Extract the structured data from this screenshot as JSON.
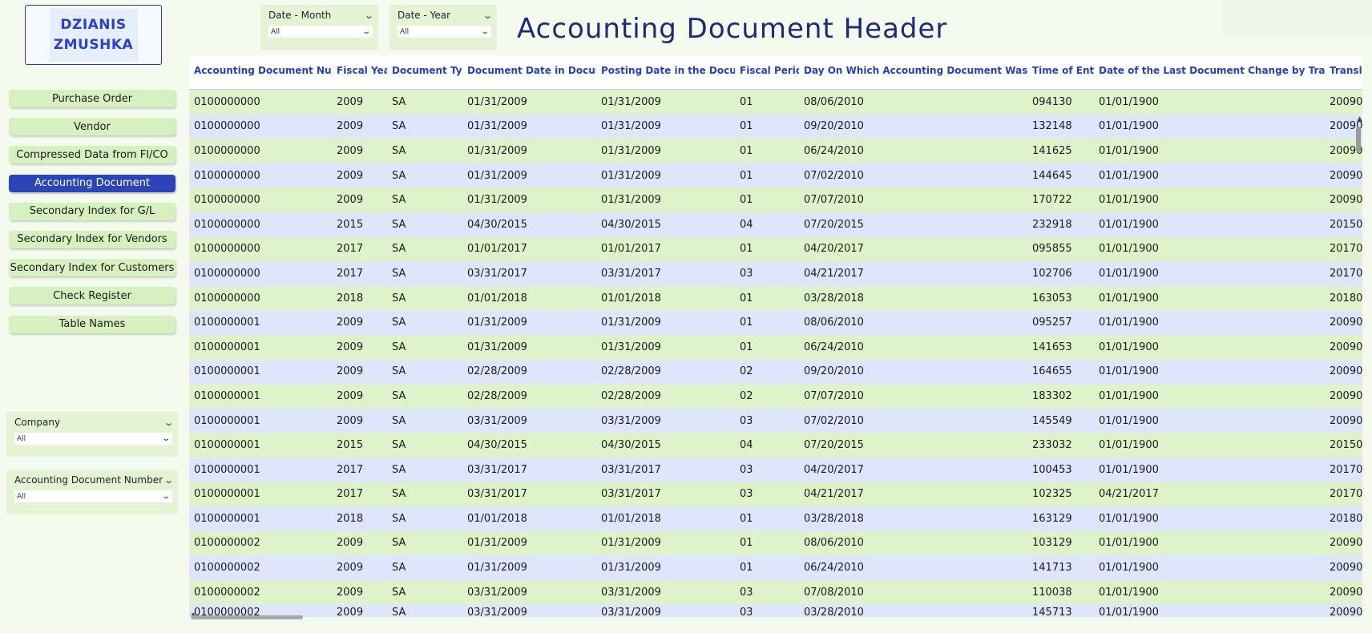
{
  "logo": {
    "line1": "DZIANIS",
    "line2": "ZMUSHKA"
  },
  "title": "Accounting Document Header",
  "nav": [
    {
      "label": "Purchase Order",
      "active": false
    },
    {
      "label": "Vendor",
      "active": false
    },
    {
      "label": "Compressed Data from FI/CO",
      "active": false
    },
    {
      "label": "Accounting Document",
      "active": true
    },
    {
      "label": "Secondary Index for G/L",
      "active": false
    },
    {
      "label": "Secondary Index for Vendors",
      "active": false
    },
    {
      "label": "Secondary Index for Customers",
      "active": false
    },
    {
      "label": "Check Register",
      "active": false
    },
    {
      "label": "Table Names",
      "active": false
    }
  ],
  "slicers": {
    "month": {
      "label": "Date - Month",
      "value": "All"
    },
    "year": {
      "label": "Date - Year",
      "value": "All"
    },
    "company": {
      "label": "Company",
      "value": "All"
    },
    "docnum": {
      "label": "Accounting Document Number",
      "value": "All"
    }
  },
  "table": {
    "columns": [
      "Accounting Document Number",
      "Fiscal Year",
      "Document Type",
      "Document Date in Document",
      "Posting Date in the Document",
      "Fiscal Period",
      "Day On Which Accounting Document Was Entered",
      "Time of Entry",
      "Date of the Last Document Change by Transaction",
      "Transl"
    ],
    "rows": [
      [
        "0100000000",
        "2009",
        "SA",
        "01/31/2009",
        "01/31/2009",
        "01",
        "08/06/2010",
        "094130",
        "01/01/1900",
        "20090"
      ],
      [
        "0100000000",
        "2009",
        "SA",
        "01/31/2009",
        "01/31/2009",
        "01",
        "09/20/2010",
        "132148",
        "01/01/1900",
        "20090"
      ],
      [
        "0100000000",
        "2009",
        "SA",
        "01/31/2009",
        "01/31/2009",
        "01",
        "06/24/2010",
        "141625",
        "01/01/1900",
        "20090"
      ],
      [
        "0100000000",
        "2009",
        "SA",
        "01/31/2009",
        "01/31/2009",
        "01",
        "07/02/2010",
        "144645",
        "01/01/1900",
        "20090"
      ],
      [
        "0100000000",
        "2009",
        "SA",
        "01/31/2009",
        "01/31/2009",
        "01",
        "07/07/2010",
        "170722",
        "01/01/1900",
        "20090"
      ],
      [
        "0100000000",
        "2015",
        "SA",
        "04/30/2015",
        "04/30/2015",
        "04",
        "07/20/2015",
        "232918",
        "01/01/1900",
        "20150"
      ],
      [
        "0100000000",
        "2017",
        "SA",
        "01/01/2017",
        "01/01/2017",
        "01",
        "04/20/2017",
        "095855",
        "01/01/1900",
        "20170"
      ],
      [
        "0100000000",
        "2017",
        "SA",
        "03/31/2017",
        "03/31/2017",
        "03",
        "04/21/2017",
        "102706",
        "01/01/1900",
        "20170"
      ],
      [
        "0100000000",
        "2018",
        "SA",
        "01/01/2018",
        "01/01/2018",
        "01",
        "03/28/2018",
        "163053",
        "01/01/1900",
        "20180"
      ],
      [
        "0100000001",
        "2009",
        "SA",
        "01/31/2009",
        "01/31/2009",
        "01",
        "08/06/2010",
        "095257",
        "01/01/1900",
        "20090"
      ],
      [
        "0100000001",
        "2009",
        "SA",
        "01/31/2009",
        "01/31/2009",
        "01",
        "06/24/2010",
        "141653",
        "01/01/1900",
        "20090"
      ],
      [
        "0100000001",
        "2009",
        "SA",
        "02/28/2009",
        "02/28/2009",
        "02",
        "09/20/2010",
        "164655",
        "01/01/1900",
        "20090"
      ],
      [
        "0100000001",
        "2009",
        "SA",
        "02/28/2009",
        "02/28/2009",
        "02",
        "07/07/2010",
        "183302",
        "01/01/1900",
        "20090"
      ],
      [
        "0100000001",
        "2009",
        "SA",
        "03/31/2009",
        "03/31/2009",
        "03",
        "07/02/2010",
        "145549",
        "01/01/1900",
        "20090"
      ],
      [
        "0100000001",
        "2015",
        "SA",
        "04/30/2015",
        "04/30/2015",
        "04",
        "07/20/2015",
        "233032",
        "01/01/1900",
        "20150"
      ],
      [
        "0100000001",
        "2017",
        "SA",
        "03/31/2017",
        "03/31/2017",
        "03",
        "04/20/2017",
        "100453",
        "01/01/1900",
        "20170"
      ],
      [
        "0100000001",
        "2017",
        "SA",
        "03/31/2017",
        "03/31/2017",
        "03",
        "04/21/2017",
        "102325",
        "04/21/2017",
        "20170"
      ],
      [
        "0100000001",
        "2018",
        "SA",
        "01/01/2018",
        "01/01/2018",
        "01",
        "03/28/2018",
        "163129",
        "01/01/1900",
        "20180"
      ],
      [
        "0100000002",
        "2009",
        "SA",
        "01/31/2009",
        "01/31/2009",
        "01",
        "08/06/2010",
        "103129",
        "01/01/1900",
        "20090"
      ],
      [
        "0100000002",
        "2009",
        "SA",
        "01/31/2009",
        "01/31/2009",
        "01",
        "06/24/2010",
        "141713",
        "01/01/1900",
        "20090"
      ],
      [
        "0100000002",
        "2009",
        "SA",
        "03/31/2009",
        "03/31/2009",
        "03",
        "07/08/2010",
        "110038",
        "01/01/1900",
        "20090"
      ],
      [
        "0100000002",
        "2009",
        "SA",
        "03/31/2009",
        "03/31/2009",
        "03",
        "03/28/2010",
        "145713",
        "01/01/1900",
        "20090"
      ]
    ]
  },
  "colors": {
    "row_green": "#dff3cb",
    "row_blue": "#dfe5fb",
    "header_text": "#2740b8",
    "active_nav": "#2b45b8",
    "title": "#1f2a75"
  }
}
